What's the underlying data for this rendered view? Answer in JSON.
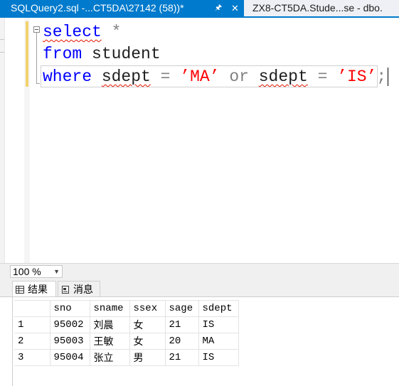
{
  "tabs": [
    {
      "label": "SQLQuery2.sql -...CT5DA\\27142 (58))*",
      "active": true
    },
    {
      "label": "ZX8-CT5DA.Stude...se - dbo.",
      "active": false
    }
  ],
  "editor": {
    "line1": {
      "kw": "select",
      "rest": " *"
    },
    "line2": {
      "kw": "from",
      "table": "student"
    },
    "line3": {
      "kw": "where",
      "col1": "sdept",
      "eq1": "=",
      "val1": "’MA’",
      "or": "or",
      "col2": "sdept",
      "eq2": "=",
      "val2": "’IS’",
      "semi": ";"
    }
  },
  "zoom": {
    "value": "100 %"
  },
  "result_tabs": {
    "results": "结果",
    "messages": "消息"
  },
  "grid": {
    "columns": [
      "",
      "sno",
      "sname",
      "ssex",
      "sage",
      "sdept"
    ],
    "rows": [
      [
        "1",
        "95002",
        "刘晨",
        "女",
        "21",
        "IS"
      ],
      [
        "2",
        "95003",
        "王敏",
        "女",
        "20",
        "MA"
      ],
      [
        "3",
        "95004",
        "张立",
        "男",
        "21",
        "IS"
      ]
    ]
  }
}
